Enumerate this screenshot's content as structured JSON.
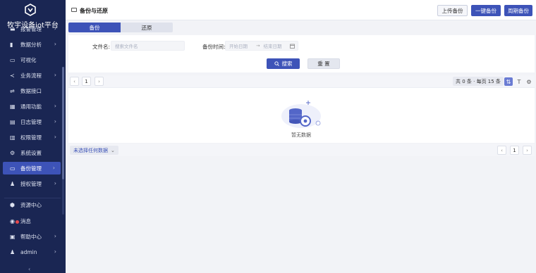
{
  "app": {
    "title": "牧宇设备iot平台",
    "accent": "#3d53b8",
    "sidebar_bg": "#1a2653"
  },
  "sidebar": {
    "items": [
      {
        "label": "报警管理",
        "icon": "alarm-icon",
        "chevron": true
      },
      {
        "label": "数据分析",
        "icon": "bar-chart-icon",
        "chevron": true
      },
      {
        "label": "可视化",
        "icon": "monitor-icon",
        "chevron": false
      },
      {
        "label": "业务流程",
        "icon": "share-icon",
        "chevron": true
      },
      {
        "label": "数据接口",
        "icon": "link-icon",
        "chevron": false
      },
      {
        "label": "通用功能",
        "icon": "grid-icon",
        "chevron": true
      },
      {
        "label": "日志管理",
        "icon": "log-icon",
        "chevron": true
      },
      {
        "label": "权限管理",
        "icon": "folder-icon",
        "chevron": true
      },
      {
        "label": "系统设置",
        "icon": "gear-icon",
        "chevron": false
      },
      {
        "label": "备份管理",
        "icon": "backup-icon",
        "chevron": true
      },
      {
        "label": "授权管理",
        "icon": "user-key-icon",
        "chevron": true
      }
    ],
    "bottom_items": [
      {
        "label": "资源中心",
        "icon": "cube-icon",
        "chevron": false
      },
      {
        "label": "消息",
        "icon": "message-icon",
        "chevron": false
      },
      {
        "label": "帮助中心",
        "icon": "help-icon",
        "chevron": true
      },
      {
        "label": "admin",
        "icon": "user-icon",
        "chevron": true
      }
    ]
  },
  "header": {
    "title": "备份与还原",
    "upload_label": "上传备份",
    "onekey_label": "一键备份",
    "period_label": "周期备份"
  },
  "tabs": [
    {
      "label": "备份"
    },
    {
      "label": "还原"
    }
  ],
  "search": {
    "filename_label": "文件名:",
    "filename_placeholder": "搜索文件名",
    "time_label": "备份时间:",
    "start_placeholder": "开始日期",
    "range_sep": "→",
    "end_placeholder": "结束日期",
    "search_label": "搜索",
    "reset_label": "重 置"
  },
  "pager": {
    "page": "1",
    "summary": "共 0 条 · 每页 15 条"
  },
  "table": {
    "empty_text": "暂无数据"
  },
  "footer": {
    "selection": "未选择任何数据",
    "page": "1"
  }
}
